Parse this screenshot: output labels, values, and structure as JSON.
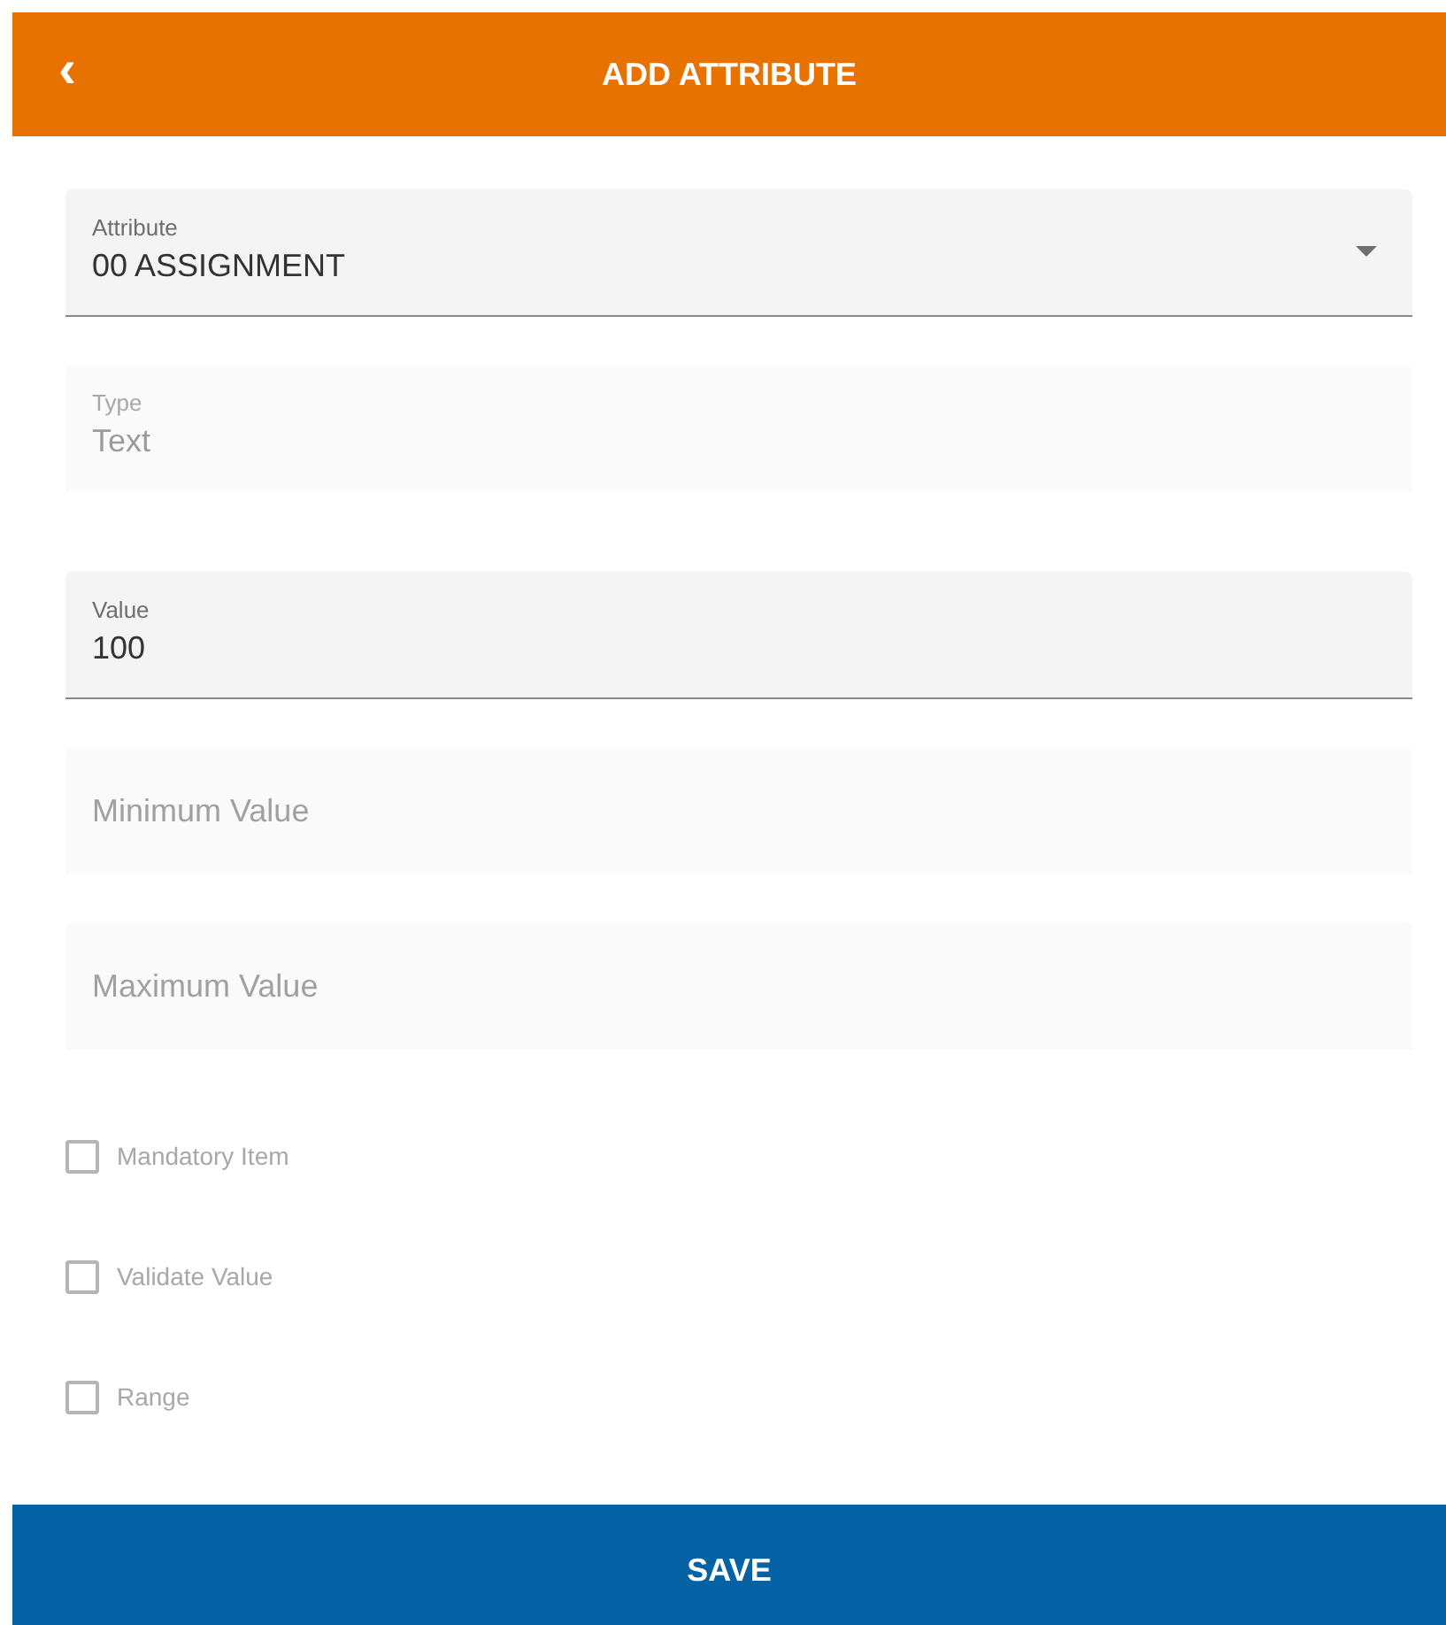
{
  "header": {
    "back": "‹",
    "title": "ADD ATTRIBUTE"
  },
  "fields": [
    {
      "kind": "select",
      "label": "Attribute",
      "value": "00 ASSIGNMENT",
      "disabled": false
    },
    {
      "kind": "text",
      "label": "Type",
      "value": "Text",
      "disabled": true
    },
    {
      "kind": "text",
      "label": "Value",
      "value": "100",
      "disabled": false
    },
    {
      "kind": "text",
      "placeholder": "Minimum Value",
      "disabled": true
    },
    {
      "kind": "text",
      "placeholder": "Maximum Value",
      "disabled": true
    }
  ],
  "checkboxes": [
    {
      "label": "Mandatory Item",
      "checked": false,
      "disabled": true
    },
    {
      "label": "Validate Value",
      "checked": false,
      "disabled": true
    },
    {
      "label": "Range",
      "checked": false,
      "disabled": true
    }
  ],
  "save_button": "SAVE"
}
